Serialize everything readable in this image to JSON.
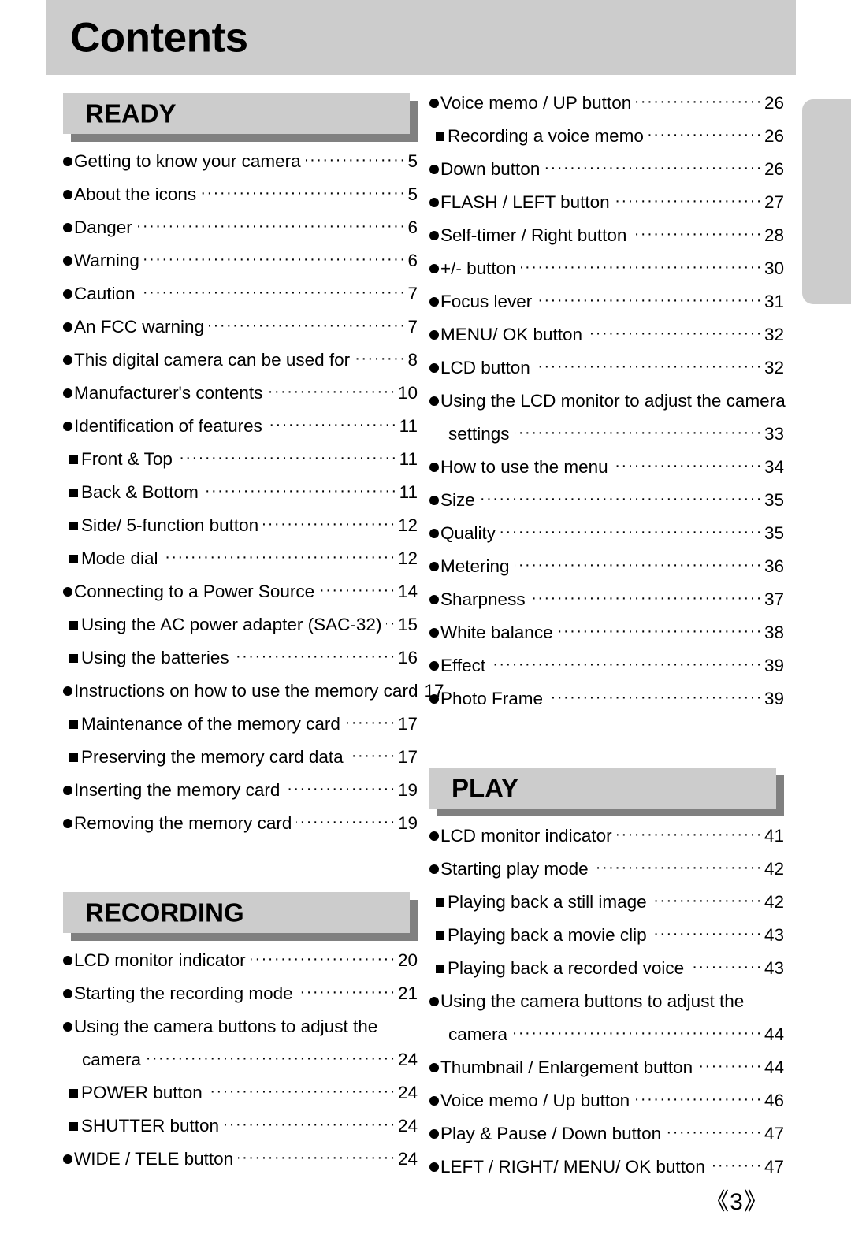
{
  "header": {
    "title": "Contents"
  },
  "edge_tab": {
    "color": "#cccccc"
  },
  "colors": {
    "banner_fill": "#cccccc",
    "banner_shadow": "#808080",
    "header_fill": "#cccccc",
    "text": "#000000"
  },
  "leader_dots": "··································································································",
  "footer": {
    "page_label": "《3》"
  },
  "left_column": {
    "sections": [
      {
        "banner": "READY",
        "entries": [
          {
            "bullet": "circle",
            "text": "Getting to know your camera",
            "page": "5"
          },
          {
            "bullet": "circle",
            "text": "About the icons",
            "page": "5"
          },
          {
            "bullet": "circle",
            "text": "Danger",
            "page": "6"
          },
          {
            "bullet": "circle",
            "text": "Warning",
            "page": "6"
          },
          {
            "bullet": "circle",
            "text": "Caution",
            "page": "7"
          },
          {
            "bullet": "circle",
            "text": "An FCC warning",
            "page": "7"
          },
          {
            "bullet": "circle",
            "text": "This digital camera can be used for",
            "page": "8"
          },
          {
            "bullet": "circle",
            "text": "Manufacturer's contents",
            "page": "10"
          },
          {
            "bullet": "circle",
            "text": "Identification of features",
            "page": "11"
          },
          {
            "bullet": "square",
            "text": "Front & Top",
            "page": "11"
          },
          {
            "bullet": "square",
            "text": "Back & Bottom",
            "page": "11"
          },
          {
            "bullet": "square",
            "text": "Side/ 5-function button",
            "page": "12"
          },
          {
            "bullet": "square",
            "text": "Mode dial",
            "page": "12"
          },
          {
            "bullet": "circle",
            "text": "Connecting to a Power Source",
            "page": "14"
          },
          {
            "bullet": "square",
            "text": "Using the AC power adapter (SAC-32)",
            "page": "15"
          },
          {
            "bullet": "square",
            "text": "Using the batteries",
            "page": "16"
          },
          {
            "bullet": "circle",
            "text": "Instructions on how to use the memory card",
            "page": "17"
          },
          {
            "bullet": "square",
            "text": "Maintenance of the memory card",
            "page": "17"
          },
          {
            "bullet": "square",
            "text": "Preserving the memory card data",
            "page": "17"
          },
          {
            "bullet": "circle",
            "text": "Inserting the memory card",
            "page": "19"
          },
          {
            "bullet": "circle",
            "text": "Removing the memory card",
            "page": "19"
          }
        ]
      },
      {
        "banner": "RECORDING",
        "entries": [
          {
            "bullet": "circle",
            "text": "LCD monitor indicator",
            "page": "20"
          },
          {
            "bullet": "circle",
            "text": "Starting the recording mode",
            "page": "21"
          },
          {
            "bullet": "circle",
            "text": "Using the camera buttons to adjust the",
            "page": ""
          },
          {
            "bullet": "none",
            "continued": true,
            "text": "camera",
            "page": "24"
          },
          {
            "bullet": "square",
            "text": "POWER button",
            "page": "24"
          },
          {
            "bullet": "square",
            "text": "SHUTTER button",
            "page": "24"
          },
          {
            "bullet": "circle",
            "text": "WIDE / TELE button",
            "page": "24"
          }
        ]
      }
    ]
  },
  "right_column": {
    "sections": [
      {
        "banner": null,
        "entries": [
          {
            "bullet": "circle",
            "text": "Voice memo / UP button",
            "page": "26"
          },
          {
            "bullet": "square",
            "text": "Recording a voice memo",
            "page": "26"
          },
          {
            "bullet": "circle",
            "text": "Down button",
            "page": "26"
          },
          {
            "bullet": "circle",
            "text": "FLASH / LEFT button",
            "page": "27"
          },
          {
            "bullet": "circle",
            "text": "Self-timer / Right button",
            "page": "28"
          },
          {
            "bullet": "circle",
            "text": "+/- button",
            "page": "30"
          },
          {
            "bullet": "circle",
            "text": "Focus lever",
            "page": "31"
          },
          {
            "bullet": "circle",
            "text": "MENU/ OK button",
            "page": "32"
          },
          {
            "bullet": "circle",
            "text": "LCD button",
            "page": "32"
          },
          {
            "bullet": "circle",
            "text": "Using the LCD monitor to adjust the camera",
            "page": ""
          },
          {
            "bullet": "none",
            "continued": true,
            "text": "settings",
            "page": "33"
          },
          {
            "bullet": "circle",
            "text": "How to use the menu",
            "page": "34"
          },
          {
            "bullet": "circle",
            "text": "Size",
            "page": "35"
          },
          {
            "bullet": "circle",
            "text": "Quality",
            "page": "35"
          },
          {
            "bullet": "circle",
            "text": "Metering",
            "page": "36"
          },
          {
            "bullet": "circle",
            "text": "Sharpness",
            "page": "37"
          },
          {
            "bullet": "circle",
            "text": "White balance",
            "page": "38"
          },
          {
            "bullet": "circle",
            "text": "Effect",
            "page": "39"
          },
          {
            "bullet": "circle",
            "text": "Photo Frame",
            "page": "39"
          }
        ]
      },
      {
        "banner": "PLAY",
        "entries": [
          {
            "bullet": "circle",
            "text": "LCD monitor indicator",
            "page": "41"
          },
          {
            "bullet": "circle",
            "text": "Starting play mode",
            "page": "42"
          },
          {
            "bullet": "square",
            "text": "Playing back a still image",
            "page": "42"
          },
          {
            "bullet": "square",
            "text": "Playing back a movie clip",
            "page": "43"
          },
          {
            "bullet": "square",
            "text": "Playing back a recorded voice",
            "page": "43"
          },
          {
            "bullet": "circle",
            "text": "Using the camera buttons to adjust the",
            "page": ""
          },
          {
            "bullet": "none",
            "continued": true,
            "text": "camera",
            "page": "44"
          },
          {
            "bullet": "circle",
            "text": "Thumbnail / Enlargement button",
            "page": "44"
          },
          {
            "bullet": "circle",
            "text": "Voice memo / Up button",
            "page": "46"
          },
          {
            "bullet": "circle",
            "text": "Play & Pause / Down button",
            "page": "47"
          },
          {
            "bullet": "circle",
            "text": "LEFT / RIGHT/ MENU/ OK button",
            "page": "47"
          }
        ]
      }
    ]
  }
}
